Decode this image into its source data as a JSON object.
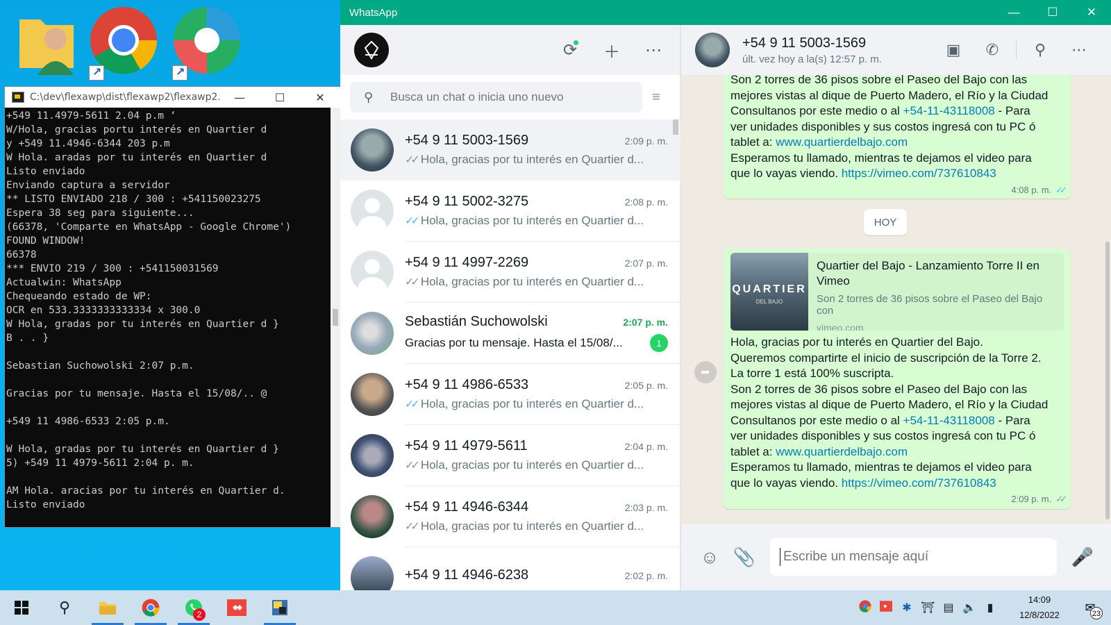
{
  "desktop": {
    "icons": [
      {
        "name": "user-folder-icon"
      },
      {
        "name": "chrome-shortcut-icon"
      },
      {
        "name": "edge-shortcut-icon"
      }
    ]
  },
  "console": {
    "title": "C:\\dev\\flexawp\\dist\\flexawp2\\flexawp2....",
    "lines": [
      "+549 11.4979-5611 2.04 p.m ‘",
      "W/Hola, gracias portu interés en Quartier d",
      "y +549 11.4946-6344 203 p.m",
      "W Hola. aradas por tu interés en Quartier d",
      "Listo enviado",
      "Enviando captura a servidor",
      "** LISTO ENVIADO 218 / 300 : +541150023275",
      "Espera 38 seg para siguiente...",
      "(66378, 'Comparte en WhatsApp - Google Chrome')",
      "FOUND WINDOW!",
      "66378",
      "*** ENVIO 219 / 300 : +541150031569",
      "Actualwin: WhatsApp",
      "Chequeando estado de WP:",
      "OCR en 533.3333333333334 x 300.0",
      "W Hola, gradas por tu interés en Quartier d }",
      "B . . }",
      "",
      "Sebastian Suchowolski 2:07 p.m.",
      "",
      "Gracias por tu mensaje. Hasta el 15/08/.. @",
      "",
      "+549 11 4986-6533 2:05 p.m.",
      "",
      "W Hola, gradas por tu interés en Quartier d }",
      "5) +549 11 4979-5611 2:04 p. m.",
      "",
      "AM Hola. aracias por tu interés en Quartier d.",
      "Listo enviado"
    ]
  },
  "whatsapp": {
    "window_title": "WhatsApp",
    "search_placeholder": "Busca un chat o inicia uno nuevo",
    "chats": [
      {
        "name": "+54 9 11 5003-1569",
        "time": "2:09 p. m.",
        "msg": "Hola, gracias por tu interés en Quartier d...",
        "tick": "read-grey",
        "avatar": "photo1",
        "active": true
      },
      {
        "name": "+54 9 11 5002-3275",
        "time": "2:08 p. m.",
        "msg": "Hola, gracias por tu interés en Quartier d...",
        "tick": "read-blue",
        "avatar": "default"
      },
      {
        "name": "+54 9 11 4997-2269",
        "time": "2:07 p. m.",
        "msg": "Hola, gracias por tu interés en Quartier d...",
        "tick": "read-grey",
        "avatar": "default"
      },
      {
        "name": "Sebastián Suchowolski",
        "time": "2:07 p. m.",
        "msg": "Gracias por tu mensaje.  Hasta el 15/08/...",
        "tick": "none",
        "avatar": "photo2",
        "unread": "1"
      },
      {
        "name": "+54 9 11 4986-6533",
        "time": "2:05 p. m.",
        "msg": "Hola, gracias por tu interés en Quartier d...",
        "tick": "read-blue",
        "avatar": "photo3"
      },
      {
        "name": "+54 9 11 4979-5611",
        "time": "2:04 p. m.",
        "msg": "Hola, gracias por tu interés en Quartier d...",
        "tick": "read-grey",
        "avatar": "photo4"
      },
      {
        "name": "+54 9 11 4946-6344",
        "time": "2:03 p. m.",
        "msg": "Hola, gracias por tu interés en Quartier d...",
        "tick": "read-grey",
        "avatar": "photo5"
      },
      {
        "name": "+54 9 11 4946-6238",
        "time": "2:02 p. m.",
        "msg": "",
        "tick": "none",
        "avatar": "photo6"
      }
    ],
    "conversation": {
      "contact_name": "+54 9 11 5003-1569",
      "contact_status": "últ. vez hoy a la(s) 12:57 p. m.",
      "day_chip": "HOY",
      "message_top": {
        "line_a": "Son 2 torres de 36 pisos sobre el Paseo del Bajo con las",
        "line_b": "mejores vistas al dique de Puerto Madero, el Río y la Ciudad",
        "line_c": "Consultanos por este medio o al ",
        "phone_link": "+54-11-43118008",
        "line_d": " - Para",
        "line_e": "ver unidades disponibles y sus costos ingresá con tu PC ó",
        "line_f": "tablet a: ",
        "site_link": "www.quartierdelbajo.com",
        "line_g": "Esperamos tu llamado, mientras te dejamos el video para",
        "line_h": "que lo vayas viendo. ",
        "video_link": "https://vimeo.com/737610843",
        "time": "4:08 p. m."
      },
      "message_main": {
        "preview_title": "Quartier del Bajo - Lanzamiento Torre II en Vimeo",
        "preview_desc": "Son 2 torres de 36 pisos sobre el Paseo del Bajo con",
        "preview_site": "vimeo.com",
        "preview_thumb_text": "QUARTIER",
        "preview_thumb_sub": "DEL BAJO",
        "line_1": "Hola, gracias por tu interés en Quartier del Bajo.",
        "line_2": "Queremos compartirte el inicio de suscripción de la Torre 2.",
        "line_3": "La torre 1 está 100% suscripta.",
        "line_4": "Son 2 torres de 36 pisos sobre el Paseo del Bajo con las",
        "line_5": "mejores vistas al dique de Puerto Madero, el Río y la Ciudad",
        "line_6": "Consultanos por este medio o al ",
        "phone_link": "+54-11-43118008",
        "line_7": " - Para",
        "line_8": "ver unidades disponibles y sus costos ingresá con tu PC ó",
        "line_9": "tablet a: ",
        "site_link": "www.quartierdelbajo.com",
        "line_10": "Esperamos tu llamado, mientras te dejamos el video para",
        "line_11": "que lo vayas viendo. ",
        "video_link": "https://vimeo.com/737610843",
        "time": "2:09 p. m."
      },
      "compose_placeholder": "Escribe un mensaje aquí"
    }
  },
  "taskbar": {
    "whatsapp_badge": "2",
    "clock_time": "14:09",
    "clock_date": "12/8/2022",
    "notifications": "23"
  },
  "colors": {
    "wa_green": "#00a884",
    "bubble_out": "#d9fdd3",
    "link": "#027eb5",
    "unread": "#25d366"
  }
}
